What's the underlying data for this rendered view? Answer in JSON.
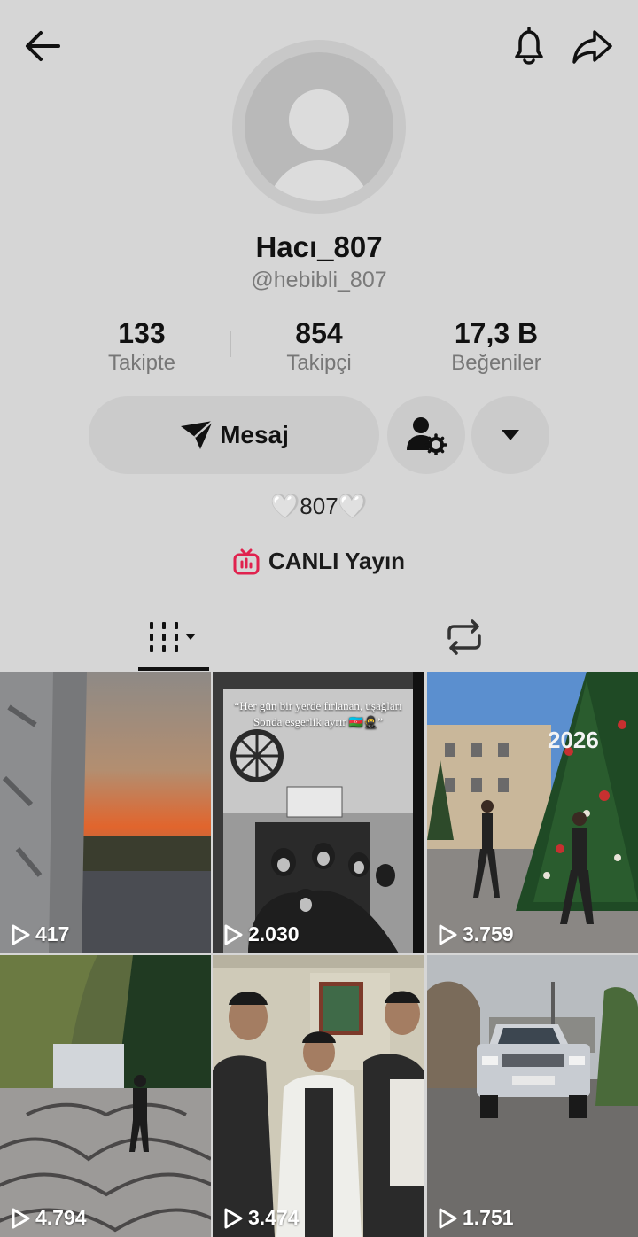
{
  "profile": {
    "display_name": "Hacı_807",
    "username": "@hebibli_807",
    "bio": "807",
    "bio_hearts": "🤍",
    "live_label": "CANLI Yayın"
  },
  "stats": [
    {
      "value": "133",
      "label": "Takipte"
    },
    {
      "value": "854",
      "label": "Takipçi"
    },
    {
      "value": "17,3 B",
      "label": "Beğeniler"
    }
  ],
  "buttons": {
    "message": "Mesaj"
  },
  "icons": {
    "back": "arrow-left-icon",
    "notifications": "bell-icon",
    "share": "share-arrow-icon",
    "message": "paper-plane-icon",
    "profile_settings": "person-gear-icon",
    "more": "caret-down-icon",
    "live": "tv-live-icon",
    "videos_tab": "grid-bars-icon",
    "reposts_tab": "repost-icon",
    "play": "play-outline-icon"
  },
  "colors": {
    "background": "#d6d6d6",
    "button": "#cbcbcb",
    "live_accent": "#e0224e",
    "muted_text": "#777777"
  },
  "videos": [
    {
      "views": "417",
      "overlay_text": ""
    },
    {
      "views": "2.030",
      "overlay_text": "“Her gün bir yerde fırlanan, uşağları Sonda esgerlik ayrır 🇦🇿🥷”"
    },
    {
      "views": "3.759",
      "overlay_text": "2026"
    },
    {
      "views": "4.794",
      "overlay_text": ""
    },
    {
      "views": "3.474",
      "overlay_text": ""
    },
    {
      "views": "1.751",
      "overlay_text": ""
    }
  ]
}
